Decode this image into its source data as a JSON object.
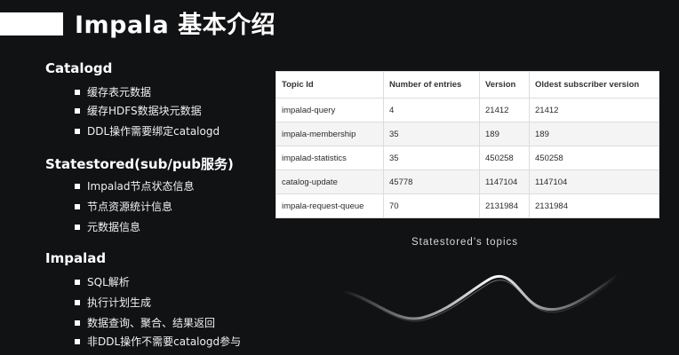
{
  "slide": {
    "title": "Impala 基本介绍"
  },
  "sections": [
    {
      "heading": "Catalogd",
      "items": [
        "缓存表元数据",
        "缓存HDFS数据块元数据",
        "DDL操作需要绑定catalogd"
      ]
    },
    {
      "heading": "Statestored(sub/pub服务)",
      "items": [
        "Impalad节点状态信息",
        "节点资源统计信息",
        "元数据信息"
      ]
    },
    {
      "heading": "Impalad",
      "items": [
        "SQL解析",
        "执行计划生成",
        "数据查询、聚合、结果返回",
        "非DDL操作不需要catalogd参与"
      ]
    }
  ],
  "table": {
    "headers": [
      "Topic Id",
      "Number of entries",
      "Version",
      "Oldest subscriber version"
    ],
    "rows": [
      [
        "impalad-query",
        "4",
        "21412",
        "21412"
      ],
      [
        "impala-membership",
        "35",
        "189",
        "189"
      ],
      [
        "impalad-statistics",
        "35",
        "450258",
        "450258"
      ],
      [
        "catalog-update",
        "45778",
        "1147104",
        "1147104"
      ],
      [
        "impala-request-queue",
        "70",
        "2131984",
        "2131984"
      ]
    ]
  },
  "caption": "Statestored's topics",
  "colors": {
    "background": "#111213",
    "text": "#ffffff",
    "table_background": "#ffffff",
    "table_alt_row": "#f4f4f4"
  }
}
